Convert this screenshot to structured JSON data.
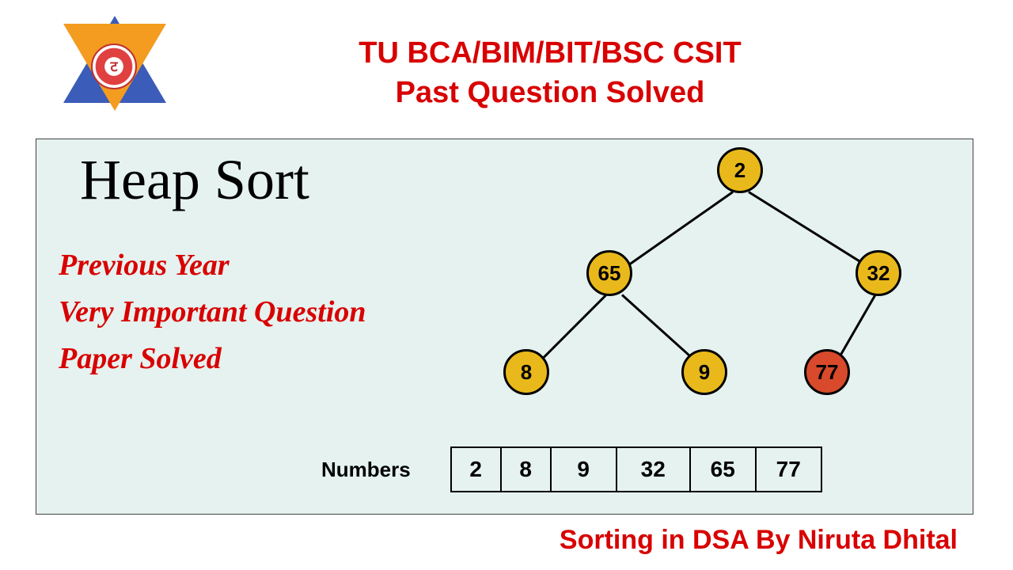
{
  "header": {
    "title_line1": "TU BCA/BIM/BIT/BSC CSIT",
    "title_line2": "Past Question Solved",
    "logo_center": "ट"
  },
  "panel": {
    "heap_title": "Heap Sort",
    "sub_line1": "Previous Year",
    "sub_line2": "Very Important Question",
    "sub_line3": "Paper Solved",
    "numbers_label": "Numbers"
  },
  "tree": {
    "root": "2",
    "left": "65",
    "right": "32",
    "ll": "8",
    "lr": "9",
    "rr": "77"
  },
  "numbers": [
    "2",
    "8",
    "9",
    "32",
    "65",
    "77"
  ],
  "footer": "Sorting in DSA By Niruta Dhital",
  "chart_data": {
    "type": "tree",
    "title": "Heap Sort",
    "nodes": [
      {
        "id": 0,
        "value": 2,
        "color": "yellow"
      },
      {
        "id": 1,
        "value": 65,
        "color": "yellow"
      },
      {
        "id": 2,
        "value": 32,
        "color": "yellow"
      },
      {
        "id": 3,
        "value": 8,
        "color": "yellow"
      },
      {
        "id": 4,
        "value": 9,
        "color": "yellow"
      },
      {
        "id": 5,
        "value": 77,
        "color": "red"
      }
    ],
    "edges": [
      [
        0,
        1
      ],
      [
        0,
        2
      ],
      [
        1,
        3
      ],
      [
        1,
        4
      ],
      [
        2,
        5
      ]
    ],
    "array_label": "Numbers",
    "array": [
      2,
      8,
      9,
      32,
      65,
      77
    ]
  }
}
